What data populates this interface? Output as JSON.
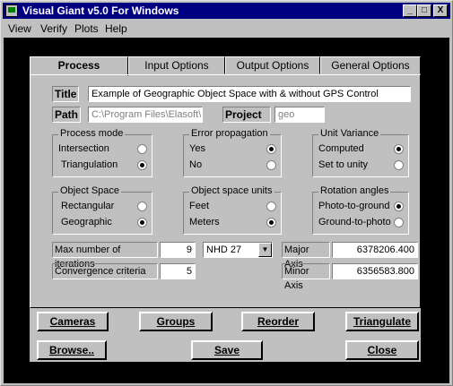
{
  "window": {
    "title": "Visual Giant v5.0 For Windows",
    "min": "_",
    "max": "□",
    "close": "X"
  },
  "menu": [
    "View",
    "Verify",
    "Plots",
    "Help"
  ],
  "tabs": [
    "Process",
    "Input Options",
    "Output Options",
    "General Options"
  ],
  "title_label": "Title",
  "title_value": "Example of Geographic Object Space with & without  GPS Control",
  "path_label": "Path",
  "path_value": "C:\\Program Files\\Elasoft\\",
  "project_label": "Project",
  "project_value": "geo",
  "process_mode": {
    "title": "Process mode",
    "options": [
      "Intersection",
      "Triangulation"
    ],
    "selected": 1
  },
  "error_prop": {
    "title": "Error propagation",
    "options": [
      "Yes",
      "No"
    ],
    "selected": 0
  },
  "unit_variance": {
    "title": "Unit Variance",
    "options": [
      "Computed",
      "Set to unity"
    ],
    "selected": 0
  },
  "object_space": {
    "title": "Object Space",
    "options": [
      "Rectangular",
      "Geographic"
    ],
    "selected": 1
  },
  "object_units": {
    "title": "Object space units",
    "options": [
      "Feet",
      "Meters"
    ],
    "selected": 1
  },
  "rotation": {
    "title": "Rotation angles",
    "options": [
      "Photo-to-ground",
      "Ground-to-photo"
    ],
    "selected": 0
  },
  "max_iter_label": "Max number of iterations",
  "max_iter_value": "9",
  "datum": "NHD 27",
  "major_axis_label": "Major Axis",
  "major_axis_value": "6378206.400",
  "conv_label": "Convergence criteria",
  "conv_value": "5",
  "minor_axis_label": "Minor Axis",
  "minor_axis_value": "6356583.800",
  "buttons": {
    "cameras": "Cameras",
    "groups": "Groups",
    "reorder": "Reorder",
    "triangulate": "Triangulate",
    "browse": "Browse..",
    "save": "Save",
    "close": "Close"
  }
}
